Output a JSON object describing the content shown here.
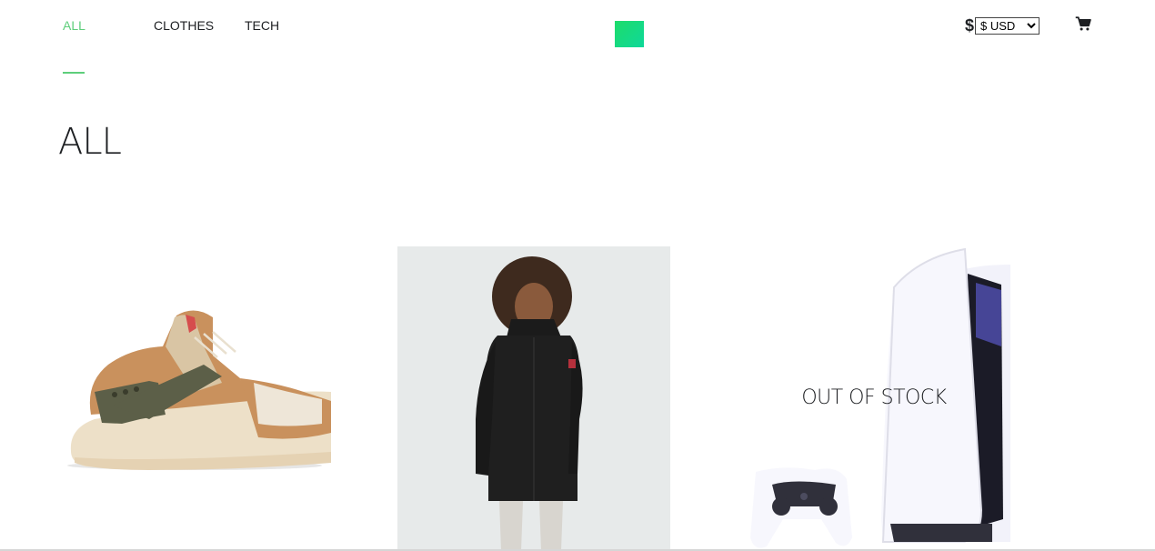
{
  "nav": {
    "categories": [
      {
        "label": "ALL",
        "active": true
      },
      {
        "label": "CLOTHES",
        "active": false
      },
      {
        "label": "TECH",
        "active": false
      }
    ]
  },
  "currency": {
    "symbol": "$",
    "selected": "$ USD"
  },
  "icons": {
    "logo": "brand-logo-icon",
    "cart": "cart-icon"
  },
  "page": {
    "title": "ALL"
  },
  "products": [
    {
      "image": "sneaker-image",
      "in_stock": true
    },
    {
      "image": "coat-image",
      "in_stock": true
    },
    {
      "image": "console-image",
      "in_stock": false,
      "stock_label": "OUT OF STOCK"
    }
  ],
  "colors": {
    "accent": "#5ece7b",
    "text": "#1d1f22"
  }
}
